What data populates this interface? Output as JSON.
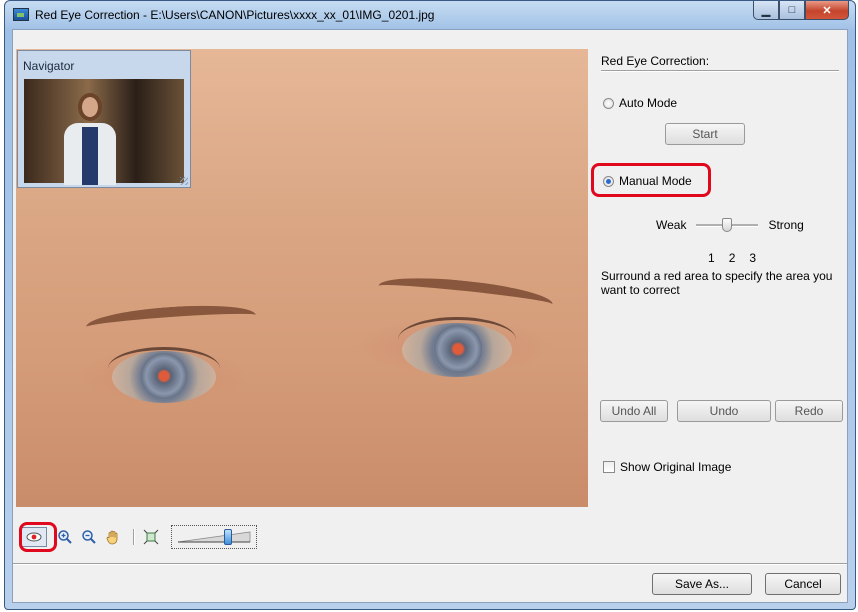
{
  "window": {
    "title": "Red Eye Correction - E:\\Users\\CANON\\Pictures\\xxxx_xx_01\\IMG_0201.jpg",
    "controls": [
      "minimize",
      "maximize",
      "close"
    ]
  },
  "navigator": {
    "title": "Navigator"
  },
  "panel": {
    "title": "Red Eye Correction:",
    "auto_mode": {
      "label": "Auto Mode",
      "selected": false
    },
    "start_button": "Start",
    "manual_mode": {
      "label": "Manual Mode",
      "selected": true
    },
    "strength": {
      "weak_label": "Weak",
      "strong_label": "Strong",
      "ticks": [
        "1",
        "2",
        "3"
      ],
      "value": 2
    },
    "hint": "Surround a red area to specify the area you want to correct",
    "undo_all_button": "Undo All",
    "undo_button": "Undo",
    "redo_button": "Redo",
    "show_original": {
      "label": "Show Original Image",
      "checked": false
    }
  },
  "toolbar": {
    "tools": [
      "red-eye-tool-icon",
      "zoom-in-icon",
      "zoom-out-icon",
      "hand-pan-icon",
      "fit-to-window-icon"
    ],
    "zoom_level": 0.7
  },
  "footer": {
    "save_as_button": "Save As...",
    "cancel_button": "Cancel"
  },
  "colors": {
    "highlight": "#e0081c",
    "window_frame": "#9fc0e6"
  }
}
